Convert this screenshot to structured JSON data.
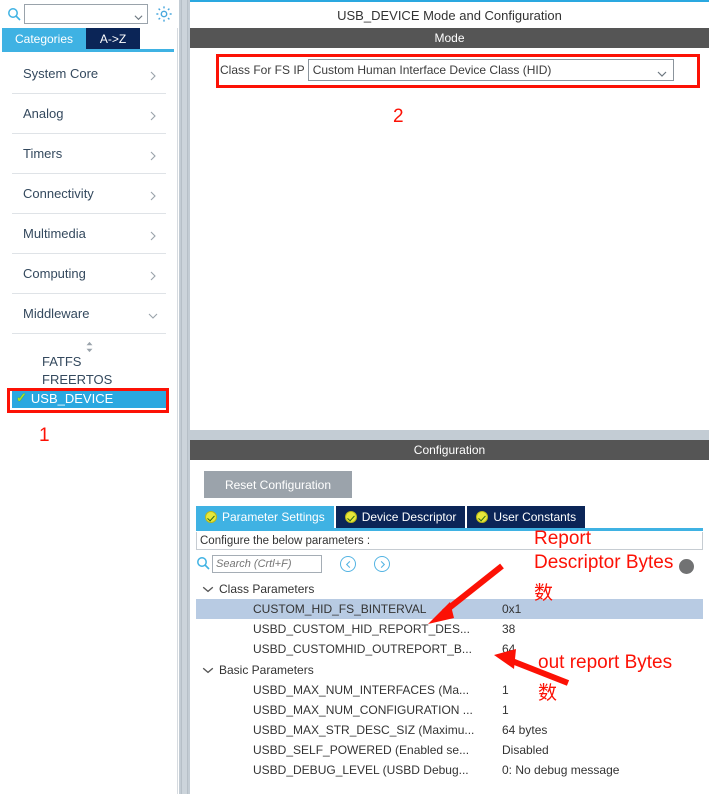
{
  "left_panel": {
    "search": {
      "value": "",
      "placeholder": ""
    },
    "gear_icon": "gear-icon",
    "tabs": [
      {
        "label": "Categories",
        "active": true
      },
      {
        "label": "A->Z",
        "active": false
      }
    ],
    "categories": [
      {
        "label": "System Core",
        "expanded": false
      },
      {
        "label": "Analog",
        "expanded": false
      },
      {
        "label": "Timers",
        "expanded": false
      },
      {
        "label": "Connectivity",
        "expanded": false
      },
      {
        "label": "Multimedia",
        "expanded": false
      },
      {
        "label": "Computing",
        "expanded": false
      },
      {
        "label": "Middleware",
        "expanded": true
      }
    ],
    "middleware_items": [
      {
        "label": "FATFS",
        "selected": false,
        "checked": false
      },
      {
        "label": "FREERTOS",
        "selected": false,
        "checked": false
      },
      {
        "label": "USB_DEVICE",
        "selected": true,
        "checked": true
      }
    ],
    "annotation_number": "1"
  },
  "mode_panel": {
    "title": "USB_DEVICE Mode and Configuration",
    "section_header": "Mode",
    "class_label": "Class For FS IP",
    "class_value": "Custom Human Interface Device Class (HID)",
    "annotation_number": "2"
  },
  "config_panel": {
    "section_header": "Configuration",
    "reset_button": "Reset Configuration",
    "tabs": [
      {
        "label": "Parameter Settings",
        "active": true
      },
      {
        "label": "Device Descriptor",
        "active": false
      },
      {
        "label": "User Constants",
        "active": false
      }
    ],
    "note": "Configure the below parameters :",
    "search": {
      "value": "",
      "placeholder": "Search (Crtl+F)"
    },
    "nav_prev_icon": "chevron-left-circle-icon",
    "nav_next_icon": "chevron-right-circle-icon",
    "groups": [
      {
        "label": "Class Parameters",
        "expanded": true,
        "rows": [
          {
            "name": "CUSTOM_HID_FS_BINTERVAL",
            "value": "0x1",
            "selected": true
          },
          {
            "name": "USBD_CUSTOM_HID_REPORT_DES...",
            "value": "38",
            "selected": false
          },
          {
            "name": "USBD_CUSTOMHID_OUTREPORT_B...",
            "value": "64",
            "selected": false
          }
        ]
      },
      {
        "label": "Basic Parameters",
        "expanded": true,
        "rows": [
          {
            "name": "USBD_MAX_NUM_INTERFACES (Ma...",
            "value": "1",
            "selected": false
          },
          {
            "name": "USBD_MAX_NUM_CONFIGURATION ...",
            "value": "1",
            "selected": false
          },
          {
            "name": "USBD_MAX_STR_DESC_SIZ (Maximu...",
            "value": "64 bytes",
            "selected": false
          },
          {
            "name": "USBD_SELF_POWERED (Enabled se...",
            "value": "Disabled",
            "selected": false
          },
          {
            "name": "USBD_DEBUG_LEVEL (USBD Debug...",
            "value": "0: No debug message",
            "selected": false
          }
        ]
      }
    ]
  },
  "annotations": {
    "report_desc_line1": "Report",
    "report_desc_line2": "Descriptor Bytes",
    "report_desc_line3": "数",
    "out_report_line1": "out report Bytes",
    "out_report_line2": "数"
  },
  "colors": {
    "accent_blue": "#3fb2e3",
    "tab_dark": "#0b2557",
    "header_gray": "#555555",
    "annotation_red": "#fc1105",
    "selection_blue": "#2aa8e0",
    "row_select": "#b8cbe3"
  }
}
